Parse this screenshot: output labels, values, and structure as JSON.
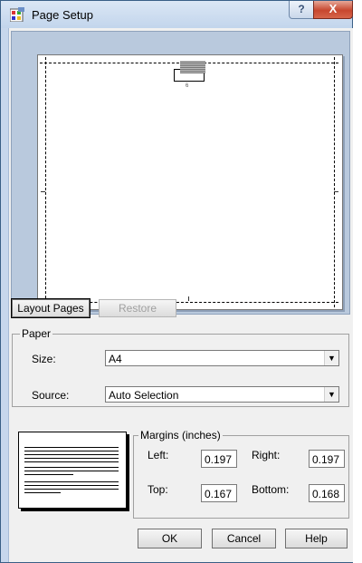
{
  "window": {
    "title": "Page Setup",
    "help_button": "?",
    "close_button": "X"
  },
  "preview": {
    "page_number": "6"
  },
  "buttons": {
    "layout_pages": "Layout Pages",
    "restore": "Restore",
    "ok": "OK",
    "cancel": "Cancel",
    "help": "Help"
  },
  "paper": {
    "group_label": "Paper",
    "size_label": "Size:",
    "size_value": "A4",
    "source_label": "Source:",
    "source_value": "Auto Selection",
    "dropdown_icon": "chevron-down-icon"
  },
  "margins": {
    "group_label": "Margins (inches)",
    "left_label": "Left:",
    "left_value": "0.197",
    "right_label": "Right:",
    "right_value": "0.197",
    "top_label": "Top:",
    "top_value": "0.167",
    "bottom_label": "Bottom:",
    "bottom_value": "0.168"
  },
  "colors": {
    "titlebar": "#c2d5ec",
    "close_button": "#c7472f",
    "dialog_bg": "#f0f0f0",
    "preview_bg": "#b9c9dd"
  }
}
